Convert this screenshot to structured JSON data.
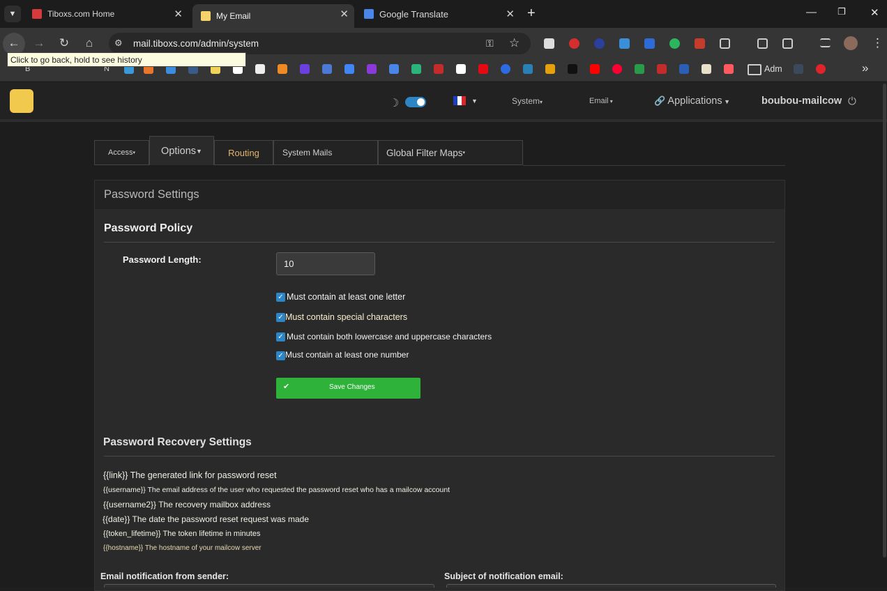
{
  "browser": {
    "tabs": [
      {
        "title": "Tiboxs.com Home"
      },
      {
        "title": "My Email"
      },
      {
        "title": "Google Translate"
      }
    ],
    "url": "mail.tiboxs.com/admin/system",
    "tooltip": "Click to go back, hold to see history",
    "bookmarks": {
      "folder_label": "Adm",
      "b_label": "B",
      "n_label": "N"
    }
  },
  "header": {
    "system_menu": "System",
    "email_menu": "Email",
    "applications_menu": "Applications",
    "username": "boubou-mailcow"
  },
  "tabs_nav": {
    "access": "Access",
    "options": "Options",
    "routing": "Routing",
    "system_mails": "System Mails",
    "global_filter_maps": "Global Filter Maps"
  },
  "password_settings": {
    "panel_title": "Password Settings",
    "policy_title": "Password Policy",
    "length_label": "Password Length:",
    "length_value": "10",
    "checks": [
      {
        "label": "Must contain at least one letter",
        "checked": true
      },
      {
        "label": "Must contain special characters",
        "checked": true
      },
      {
        "label": "Must contain both lowercase and uppercase characters",
        "checked": true
      },
      {
        "label": "Must contain at least one number",
        "checked": true
      }
    ],
    "save_button": "Save Changes"
  },
  "recovery": {
    "title": "Password Recovery Settings",
    "vars": [
      {
        "key": "{{link}}",
        "desc": "The generated link for password reset"
      },
      {
        "key": "{{username}}",
        "desc": "The email address of the user who requested the password reset who has a mailcow account"
      },
      {
        "key": "{{username2}}",
        "desc": "The recovery mailbox address"
      },
      {
        "key": "{{date}}",
        "desc": "The date the password reset request was made"
      },
      {
        "key": "{{token_lifetime}}",
        "desc": "The token lifetime in minutes"
      },
      {
        "key": "{{hostname}}",
        "desc": "The hostname of your mailcow server"
      }
    ],
    "sender_label": "Email notification from sender:",
    "subject_label": "Subject of notification email:"
  },
  "colors": {
    "accent_blue": "#2d85c5",
    "save_green": "#2fb239",
    "routing_text": "#e0b46c"
  }
}
